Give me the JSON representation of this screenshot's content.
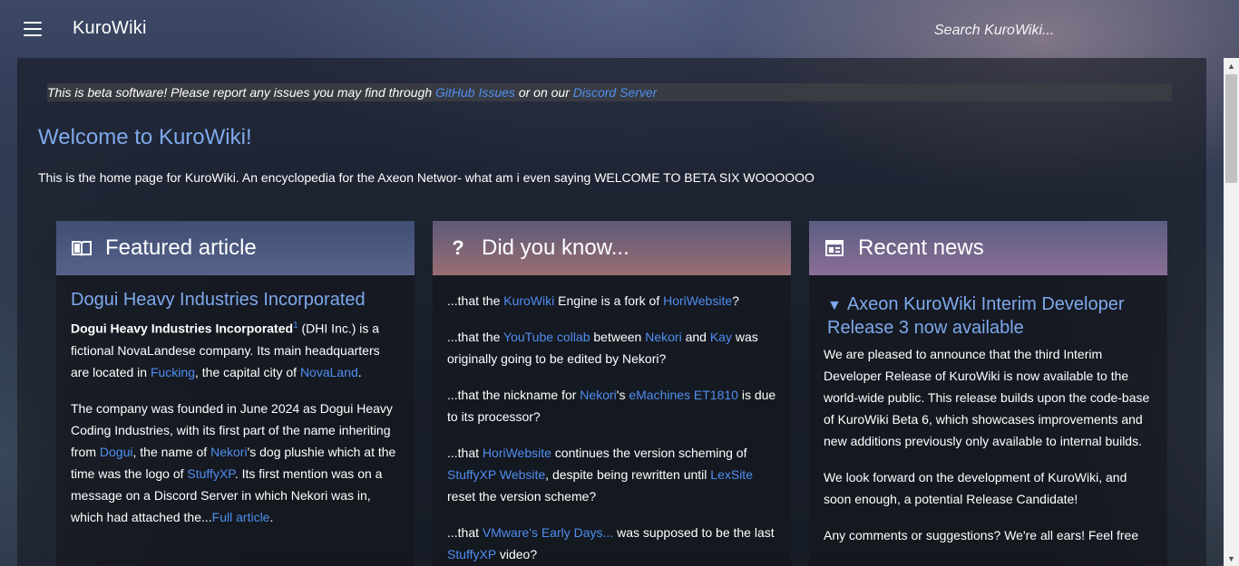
{
  "header": {
    "brand": "KuroWiki",
    "search_placeholder": "Search KuroWiki..."
  },
  "beta_notice": {
    "text_before": "This is beta software! Please report any issues you may find through ",
    "link1": "GitHub Issues",
    "text_middle": " or on our ",
    "link2": "Discord Server"
  },
  "welcome": {
    "title": "Welcome to KuroWiki!",
    "intro": "This is the home page for KuroWiki. An encyclopedia for the Axeon Networ- what am i even saying WELCOME TO BETA SIX WOOOOOO"
  },
  "featured": {
    "heading": "Featured article",
    "icon": "book-open-icon",
    "title": "Dogui Heavy Industries Incorporated",
    "p1_bold": "Dogui Heavy Industries Incorporated",
    "p1_sup": "1",
    "p1_a": " (DHI Inc.) is a fictional NovaLandese company. Its main headquarters are located in ",
    "p1_link1": "Fucking",
    "p1_b": ", the capital city of ",
    "p1_link2": "NovaLand",
    "p1_c": ".",
    "p2_a": "The company was founded in June 2024 as Dogui Heavy Coding Industries, with its first part of the name inheriting from ",
    "p2_link1": "Dogui",
    "p2_b": ", the name of ",
    "p2_link2": "Nekori",
    "p2_c": "'s dog plushie which at the time was the logo of ",
    "p2_link3": "StuffyXP",
    "p2_d": ". Its first mention was on a message on a Discord Server in which Nekori was in, which had attached the...",
    "p2_link4": "Full article",
    "p2_e": "."
  },
  "dyk": {
    "heading": "Did you know...",
    "icon": "question-mark-icon",
    "i1_a": "...that the ",
    "i1_l1": "KuroWiki",
    "i1_b": " Engine is a fork of ",
    "i1_l2": "HoriWebsite",
    "i1_c": "?",
    "i2_a": "...that the ",
    "i2_l1": "YouTube collab",
    "i2_b": " between ",
    "i2_l2": "Nekori",
    "i2_c": " and ",
    "i2_l3": "Kay",
    "i2_d": " was originally going to be edited by Nekori?",
    "i3_a": "...that the nickname for ",
    "i3_l1": "Nekori",
    "i3_b": "'s ",
    "i3_l2": "eMachines ET1810",
    "i3_c": " is due to its processor?",
    "i4_a": "...that ",
    "i4_l1": "HoriWebsite",
    "i4_b": " continues the version scheming of ",
    "i4_l2": "StuffyXP Website",
    "i4_c": ", despite being rewritten until ",
    "i4_l3": "LexSite",
    "i4_d": " reset the version scheme?",
    "i5_a": "...that ",
    "i5_l1": "VMware's Early Days...",
    "i5_b": " was supposed to be the last ",
    "i5_l2": "StuffyXP",
    "i5_c": " video?"
  },
  "news": {
    "heading": "Recent news",
    "icon": "newspaper-icon",
    "toggle": "▼",
    "title": "Axeon KuroWiki Interim Developer Release 3 now available",
    "p1": "We are pleased to announce that the third Interim Developer Release of KuroWiki is now available to the world-wide public. This release builds upon the code-base of KuroWiki Beta 6, which showcases improvements and new additions previously only available to internal builds.",
    "p2": "We look forward on the development of KuroWiki, and soon enough, a potential Release Candidate!",
    "p3": "Any comments or suggestions? We're all ears! Feel free"
  },
  "scrollbar": {
    "up": "▲",
    "down": "▼"
  }
}
